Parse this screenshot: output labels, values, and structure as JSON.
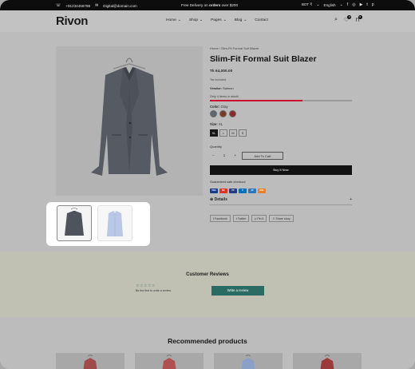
{
  "topbar": {
    "phone": "+91234456789",
    "email": "Digital@domain.com",
    "delivery_prefix": "Free Delivery on",
    "delivery_bold": "orders",
    "delivery_suffix": "over $200",
    "currency": "BDT ₹",
    "language": "English"
  },
  "header": {
    "logo": "Rivon",
    "nav": [
      "Home",
      "Shop",
      "Pages",
      "Blog",
      "Contact"
    ],
    "wishlist_count": "0",
    "cart_count": "0"
  },
  "product": {
    "breadcrumb": "Home  /  Slim-Fit Formal Suit Blazer",
    "title": "Slim-Fit Formal Suit Blazer",
    "price": "Tk 64,000.00",
    "tax_note": "Tax included.",
    "vendor_label": "Vendor:",
    "vendor": "Salmon",
    "stock_text": "Only 4 items in stock!",
    "stock_fraction": 0.65,
    "color_label": "Color:",
    "color_value": "Gray",
    "swatches": [
      "#5f6670",
      "#7a3b26",
      "#8b2b2b"
    ],
    "size_label": "Size:",
    "size_value": "XL",
    "sizes": [
      "XL",
      "L",
      "M",
      "S"
    ],
    "quantity_label": "Quantity",
    "quantity_value": "1",
    "add_to_cart": "Add To Cart",
    "buy_now": "Buy It Now",
    "secure_text": "Guaranteed safe checkout",
    "payments": [
      "VISA",
      "MC",
      "PP",
      "P",
      "AP",
      "DSC"
    ],
    "payment_colors": [
      "#1a3b8c",
      "#d9381e",
      "#253b80",
      "#0070ba",
      "#2e77bc",
      "#e5822b"
    ],
    "details_label": "Details",
    "shares": [
      "Facebook",
      "Twitter",
      "Pin it",
      "Share story"
    ]
  },
  "reviews": {
    "title": "Customer Reviews",
    "stars": "☆☆☆☆☆",
    "first_text": "Be the first to write a review",
    "write_button": "Write a review"
  },
  "recommended": {
    "title": "Recommended products"
  }
}
